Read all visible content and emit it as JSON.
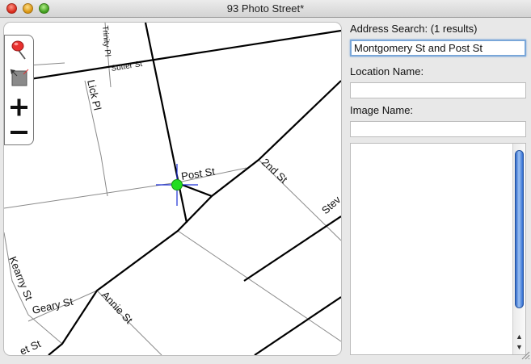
{
  "window": {
    "title": "93 Photo Street*"
  },
  "map": {
    "streets": {
      "trinity_pl": "Trinity Pl",
      "sutter_st": "Sutter St",
      "lick_pl": "Lick Pl",
      "post_st": "Post St",
      "second_st": "2nd St",
      "stev": "Stev",
      "kearny_st": "Kearny St",
      "geary_st": "Geary St",
      "annie_st": "Annie St",
      "bottom_st": "et St"
    },
    "colors": {
      "marker": "#22dd22",
      "crosshair": "#1b2fd6",
      "pin": "#e8302e"
    }
  },
  "toolbox": {
    "tools": [
      {
        "icon": "pushpin-icon"
      },
      {
        "icon": "select-box-icon"
      },
      {
        "icon": "zoom-in-icon",
        "glyph": "+"
      },
      {
        "icon": "zoom-out-icon",
        "glyph": "−"
      }
    ]
  },
  "panel": {
    "address_label": "Address Search: (1 results)",
    "address_value": "Montgomery St and Post St",
    "location_label": "Location Name:",
    "location_value": "",
    "image_label": "Image Name:",
    "image_value": "",
    "notes_value": ""
  }
}
